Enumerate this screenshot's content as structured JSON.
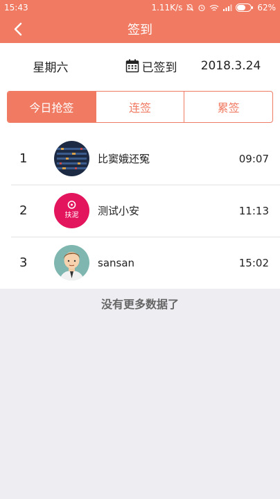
{
  "status_bar": {
    "time": "15:43",
    "net_speed": "1.11K/s",
    "battery": "62%"
  },
  "nav": {
    "title": "签到"
  },
  "info": {
    "weekday": "星期六",
    "signed_label": "已签到",
    "date": "2018.3.24"
  },
  "tabs": [
    {
      "label": "今日抢签",
      "active": true
    },
    {
      "label": "连签",
      "active": false
    },
    {
      "label": "累签",
      "active": false
    }
  ],
  "list": [
    {
      "rank": "1",
      "name": "比窦娥还冤",
      "time": "09:07"
    },
    {
      "rank": "2",
      "name": "测试小安",
      "time": "11:13",
      "avatar_text": "扶泥"
    },
    {
      "rank": "3",
      "name": "sansan",
      "time": "15:02"
    }
  ],
  "footer": {
    "no_more": "没有更多数据了"
  },
  "colors": {
    "accent": "#f07a62",
    "background": "#eeedf2"
  }
}
